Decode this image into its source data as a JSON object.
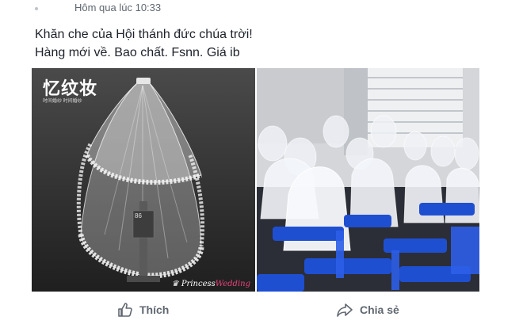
{
  "post": {
    "timestamp": "Hôm qua lúc 10:33",
    "lines": [
      "Khăn che của Hội thánh đức chúa trời!",
      "Hàng mới về. Bao chất. Fsnn. Giá ib"
    ]
  },
  "photo_left": {
    "brand": "忆纹妆",
    "brand_sub": "时间婚纱  时间婚纱",
    "tag": "86",
    "watermark_a": "Princess",
    "watermark_b": "Wedding"
  },
  "actions": {
    "like_label": "Thích",
    "share_label": "Chia sẻ"
  },
  "colors": {
    "text": "#1d2129",
    "muted": "#606770",
    "chair_blue": "#1f4fd1"
  }
}
